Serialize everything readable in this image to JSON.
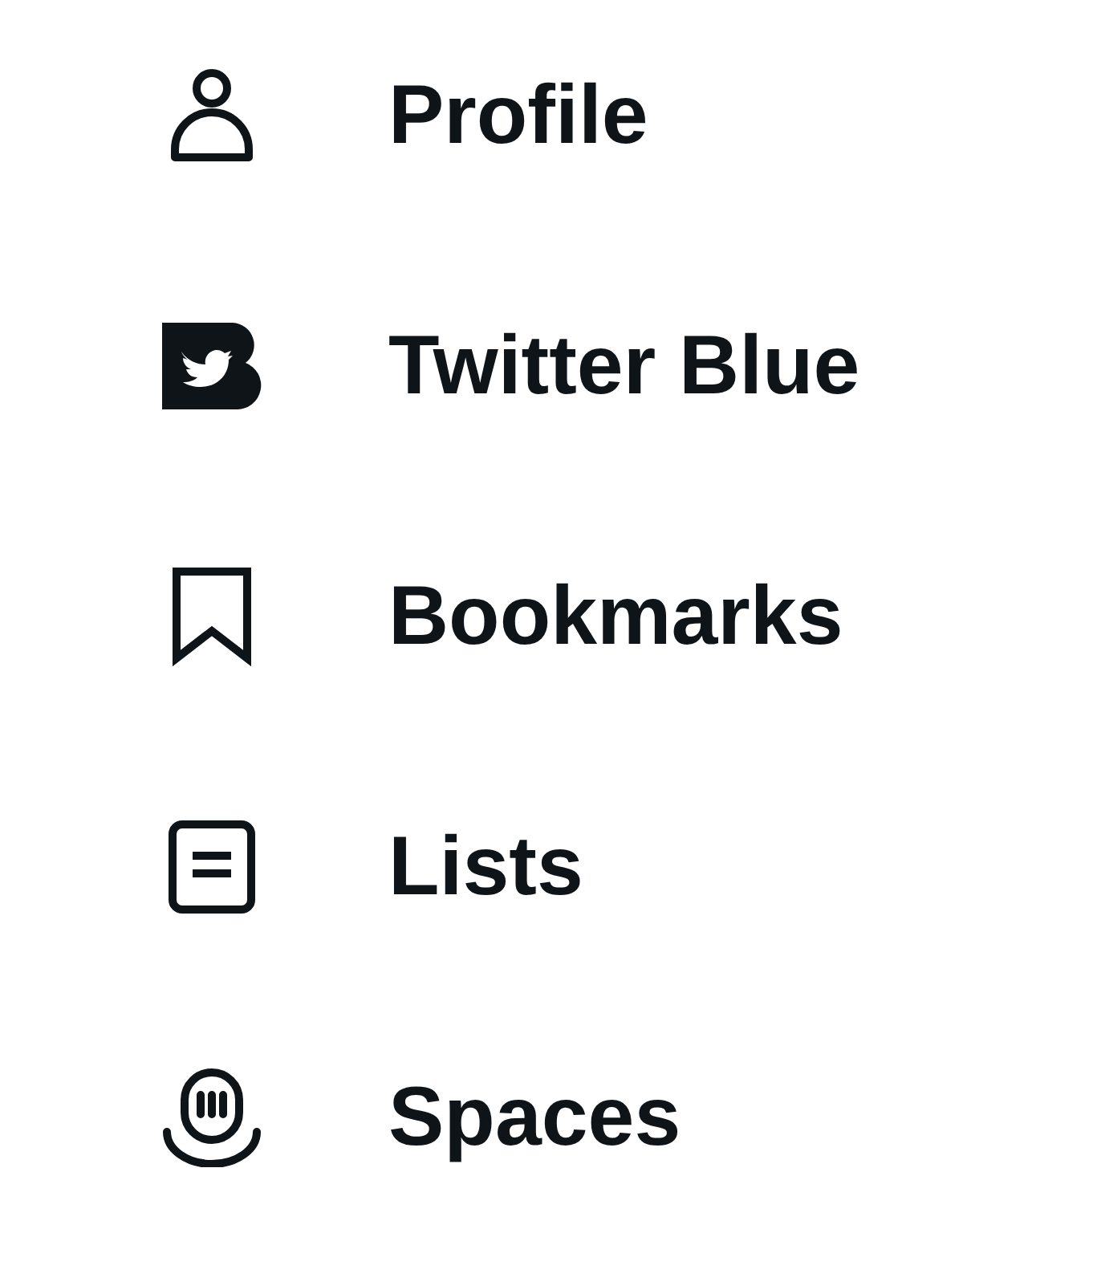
{
  "menu": [
    {
      "kind": "profile",
      "label": "Profile"
    },
    {
      "kind": "blue",
      "label": "Twitter Blue"
    },
    {
      "kind": "bookmarks",
      "label": "Bookmarks"
    },
    {
      "kind": "lists",
      "label": "Lists"
    },
    {
      "kind": "spaces",
      "label": "Spaces"
    }
  ]
}
